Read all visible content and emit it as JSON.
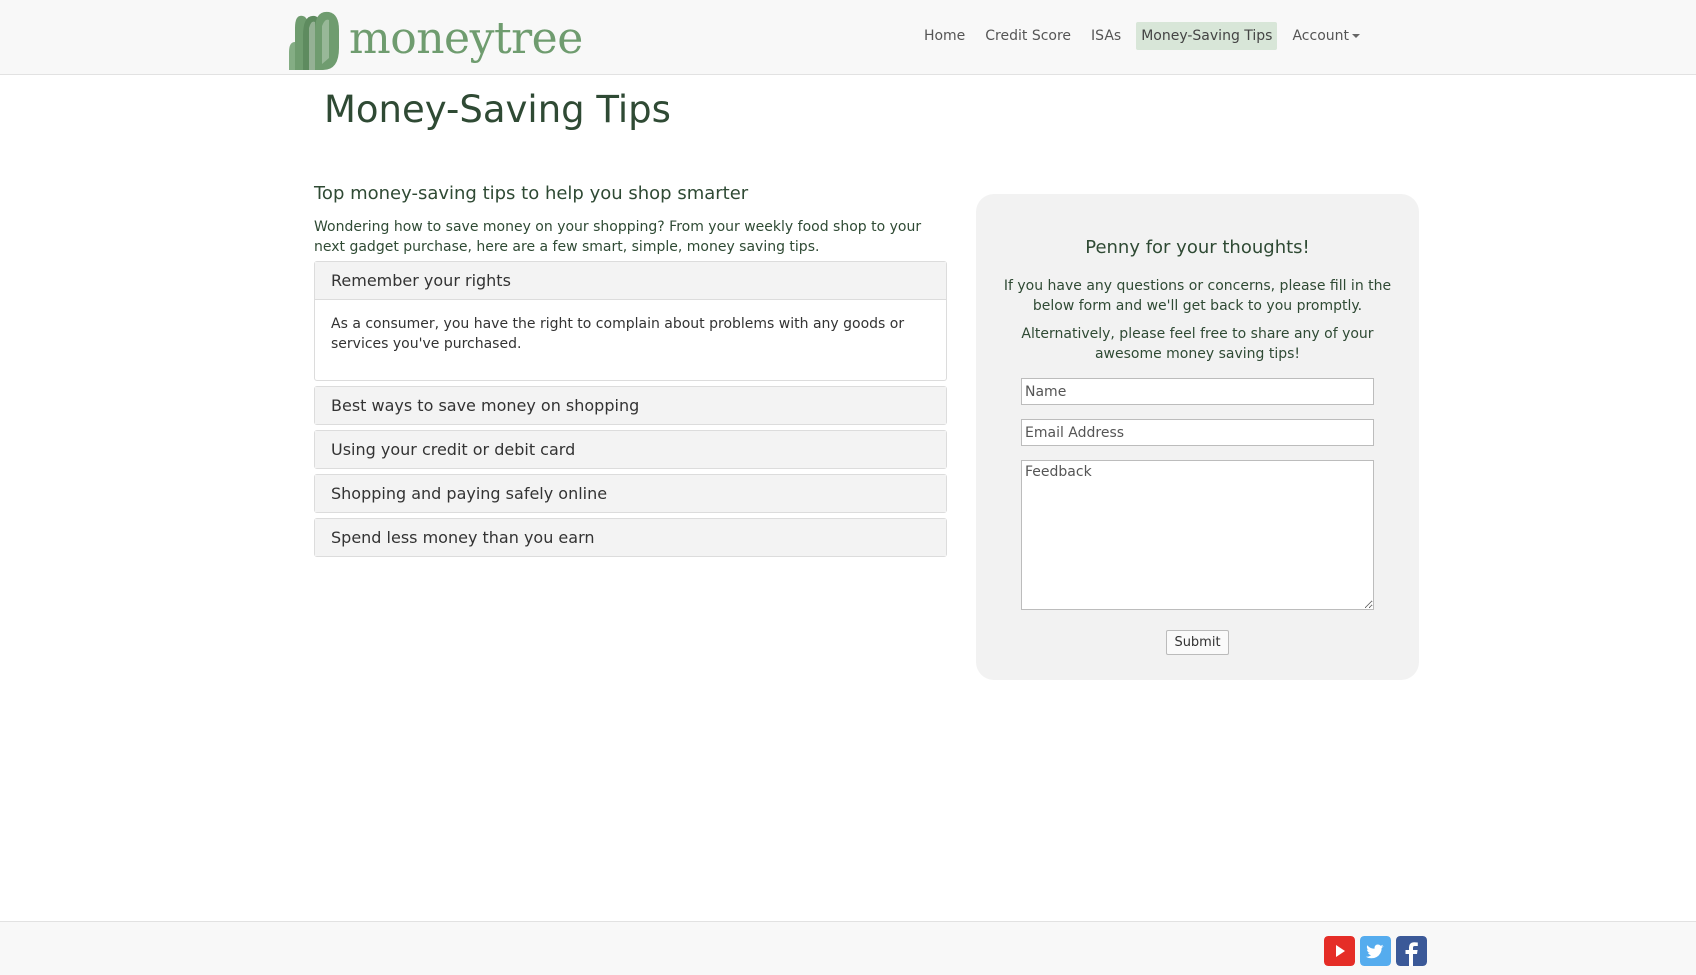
{
  "header": {
    "logo_text": "moneytree",
    "nav": [
      {
        "label": "Home",
        "active": false
      },
      {
        "label": "Credit Score",
        "active": false
      },
      {
        "label": "ISAs",
        "active": false
      },
      {
        "label": "Money-Saving Tips",
        "active": true
      },
      {
        "label": "Account",
        "active": false,
        "dropdown": true
      }
    ]
  },
  "page": {
    "title": "Money-Saving Tips",
    "section_heading": "Top money-saving tips to help you shop smarter",
    "intro": "Wondering how to save money on your shopping? From your weekly food shop to your next gadget purchase, here are a few smart, simple, money saving tips.",
    "accordion": [
      {
        "title": "Remember your rights",
        "expanded": true,
        "body": "As a consumer, you have the right to complain about problems with any goods or services you've purchased."
      },
      {
        "title": "Best ways to save money on shopping",
        "expanded": false
      },
      {
        "title": "Using your credit or debit card",
        "expanded": false
      },
      {
        "title": "Shopping and paying safely online",
        "expanded": false
      },
      {
        "title": "Spend less money than you earn",
        "expanded": false
      }
    ]
  },
  "feedback": {
    "title": "Penny for your thoughts!",
    "text1": "If you have any questions or concerns, please fill in the below form and we'll get back to you promptly.",
    "text2": "Alternatively, please feel free to share any of your awesome money saving tips!",
    "name_placeholder": "Name",
    "email_placeholder": "Email Address",
    "feedback_placeholder": "Feedback",
    "submit_label": "Submit"
  },
  "footer": {
    "social": [
      {
        "icon": "youtube-icon",
        "color": "#e52d27"
      },
      {
        "icon": "twitter-icon",
        "color": "#55acee"
      },
      {
        "icon": "facebook-icon",
        "color": "#3b5998"
      }
    ]
  },
  "colors": {
    "brand_green": "#6f9c6f",
    "text_green": "#2f4a34",
    "nav_active_bg": "#d8e6d8"
  }
}
